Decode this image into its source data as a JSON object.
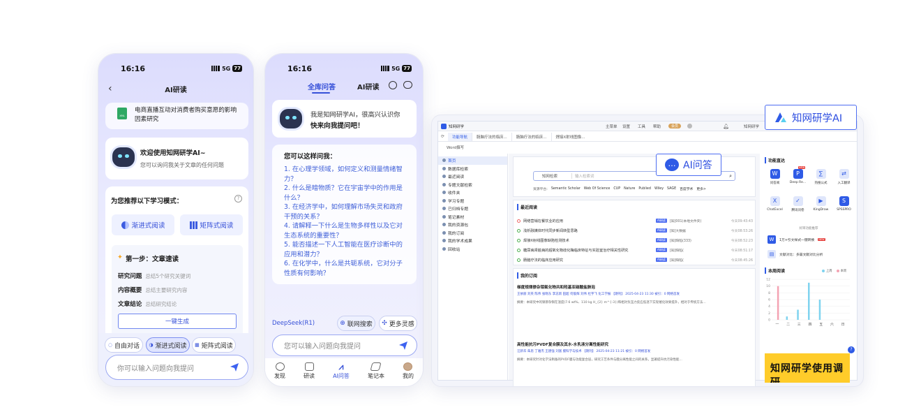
{
  "phone1": {
    "time": "16:16",
    "network": "5G",
    "battery": "77",
    "title": "AI研读",
    "file_name": "电商直播互动对消费者购买意愿的影响因素研究",
    "file_ext": "XML",
    "welcome_title": "欢迎使用知网研学AI~",
    "welcome_sub": "您可以询问我关于文章的任何问题",
    "recommend_title": "为您推荐以下学习模式：",
    "mode_progressive": "渐进式阅读",
    "mode_matrix": "矩阵式阅读",
    "step_title": "第一步：文章速读",
    "step_items": [
      {
        "label": "研究问题",
        "desc": "总结5个研究关键词"
      },
      {
        "label": "内容概要",
        "desc": "总结主要研究内容"
      },
      {
        "label": "文章结论",
        "desc": "总结研究结论"
      }
    ],
    "generate_button": "一键生成",
    "chips": [
      "自由对话",
      "渐进式阅读",
      "矩阵式阅读"
    ],
    "input_placeholder": "你可以输入问题向我提问"
  },
  "phone2": {
    "time": "16:16",
    "network": "5G",
    "battery": "77",
    "tab_all": "全库问答",
    "tab_ai": "AI研读",
    "greeting_1": "我是知网研学AI，很高兴认识你",
    "greeting_2": "快来向我提问吧！",
    "ask_title": "您可以这样问我：",
    "questions": [
      "1. 在心理学领域，如何定义和测量情绪智力？",
      "2. 什么是暗物质？它在宇宙学中的作用是什么？",
      "3. 在经济学中，如何理解市场失灵和政府干预的关系？",
      "4. 请解释一下什么是生物多样性以及它对生态系统的重要性？",
      "5. 能否描述一下人工智能在医疗诊断中的应用和潜力？",
      "6. 在化学中，什么是共轭系统，它对分子性质有何影响？"
    ],
    "model": "DeepSeek(R1)",
    "web_search": "联网搜索",
    "more_ideas": "更多灵感",
    "input_placeholder": "您可以输入问题向我提问",
    "tabs": [
      "发现",
      "研读",
      "AI问答",
      "笔记本",
      "我的"
    ]
  },
  "desktop": {
    "app_name": "知网研学",
    "top_menu": [
      "主菜单",
      "设置",
      "工具",
      "帮助"
    ],
    "vip": "会员",
    "user": "知网研学",
    "tabs": [
      "功能导航",
      "肠脑疗法的临床...",
      "肠脑疗法的临床...",
      "焊接X射线图像..."
    ],
    "word_btn": "Word撰写",
    "sidebar": [
      "首页",
      "数据库检索",
      "最近阅读",
      "专题文献检索",
      "收件夹",
      "学习专题",
      "已归档专题",
      "笔记素材",
      "我的资源包",
      "我的订阅",
      "我的学术成果",
      "回收站"
    ],
    "search_select": "知网检索",
    "search_placeholder": "输入检索词",
    "sources_label": "资源平台:",
    "sources": [
      "Semantic Scholar",
      "Web Of Science",
      "CUP",
      "Nature",
      "Publied",
      "Wiley",
      "SAGE",
      "百度学术",
      "更多>"
    ],
    "recent_title": "最近阅读",
    "recent_items": [
      {
        "title": "网络营销在餐饮业的应用",
        "src": "[知]001(本地文件夹)",
        "time": "今天09:43:43"
      },
      {
        "title": "浅析融媒体时代同步新闻转型思路",
        "src": "[知]大数据",
        "time": "今天08:53:26"
      },
      {
        "title": "焊接X射线图像缺陷检测技术",
        "src": "[知]缺陷(333)",
        "time": "今天08:52:23"
      },
      {
        "title": "糖尿病肾脏病的超氧化物歧化酶临床特征与实验室治疗相关性研究",
        "src": "[知]缺陷(",
        "time": "今天08:51:17"
      },
      {
        "title": "肠脑疗法的临床应用研究",
        "src": "[知]缺陷(",
        "time": "今天08:45:26"
      }
    ],
    "sub_title": "我的订阅",
    "sub_items": [
      {
        "title": "梯度规律掺杂钼氧化物共和羟基亚硝酸盐肺泡",
        "authors": "王依丽 刘英 陈伟 张晓东 李志新 田超 何俊辉 刘伟 杜宇飞 化工学报 【期刊】 2025-04-23 11:30 被引：0 网络首发",
        "body": "摘要：本研究中的钼掺杂铜在温度(7.6 wt%、110 kg H_{2} m^{-3})和相对负压力反应低温下实现催化效果提升，相对于传统方法…"
      },
      {
        "title": "高性能抗污PVDF复合膜及其水-水乳液分离性能研究",
        "authors": "汪新华 朱思 丁雅杰 王建强 刘富 膜科学与技术 【期刊】 2025-04-23 11:21 被引：0 网络首发",
        "body": "摘要：本研究针对化学法制备的PVDF膜与功能复合层，研究工艺条件与膜分离性能之间的关系，显著提升抗污染性能…"
      }
    ],
    "func_title": "功能直达",
    "funcs": [
      "问答阅",
      "Deep Re...",
      "热搜公式",
      "入工翻译",
      "ChatExcel",
      "腾讯问卷",
      "KingDraw",
      "SPSSPRO"
    ],
    "new_tag": "NEW",
    "recommend_caption": "好目功能推荐",
    "tool1": "1万+引文样式一键转换",
    "tool2": "文献对比：多篇文献对比分析",
    "week_title": "本周阅读",
    "legend": [
      "上周",
      "本周"
    ],
    "week_days": [
      "一",
      "二",
      "三",
      "四",
      "五",
      "六",
      "日"
    ],
    "y_ticks": [
      "12",
      "10",
      "8",
      "6",
      "4",
      "2",
      "0"
    ],
    "banner_text": "知网研学使用调研"
  },
  "badges": {
    "brand": "知网研学AI",
    "ai_qa": "AI问答"
  },
  "chart_data": {
    "type": "bar",
    "title": "本周阅读",
    "categories": [
      "一",
      "二",
      "三",
      "四",
      "五",
      "六",
      "日"
    ],
    "series": [
      {
        "name": "上周",
        "values": [
          0,
          1,
          3,
          11,
          6,
          0,
          0
        ]
      },
      {
        "name": "本周",
        "values": [
          10,
          0,
          0,
          0,
          0,
          0,
          0
        ]
      }
    ],
    "ylim": [
      0,
      12
    ],
    "colors": [
      "#7fd3ef",
      "#f4a3b3"
    ]
  }
}
